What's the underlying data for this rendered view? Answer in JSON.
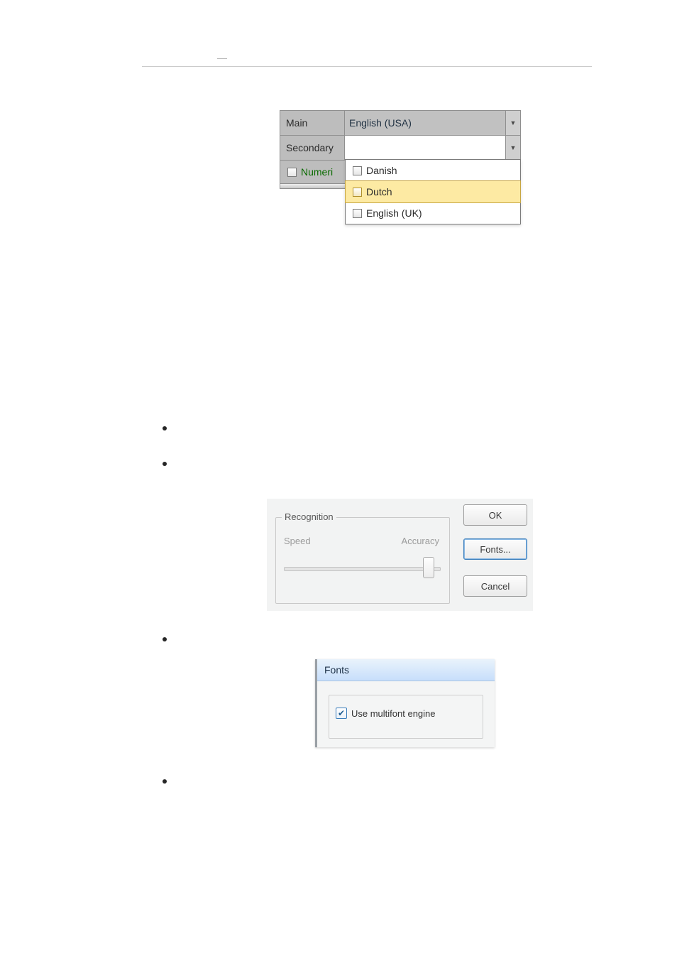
{
  "figure1": {
    "main_label": "Main",
    "main_value": "English (USA)",
    "secondary_label": "Secondary",
    "secondary_value": "",
    "numeric_label": "Numeri",
    "options": [
      {
        "label": "Danish",
        "selected": false
      },
      {
        "label": "Dutch",
        "selected": true
      },
      {
        "label": "English (UK)",
        "selected": false
      }
    ]
  },
  "figure2": {
    "group_title": "Recognition",
    "left_label": "Speed",
    "right_label": "Accuracy",
    "buttons": {
      "ok": "OK",
      "fonts": "Fonts...",
      "cancel": "Cancel"
    }
  },
  "figure3": {
    "title": "Fonts",
    "checkbox_label": "Use multifont engine",
    "checkbox_checked": true
  }
}
